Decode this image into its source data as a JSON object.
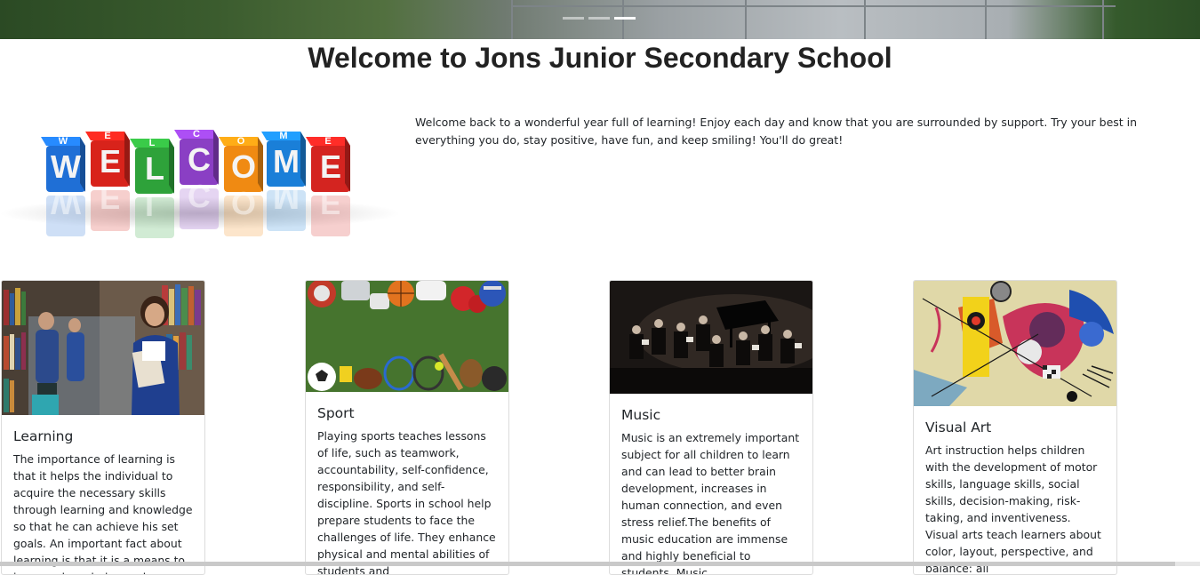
{
  "carousel": {
    "slides": 3,
    "active_index": 2
  },
  "page": {
    "title": "Welcome to Jons Junior Secondary School",
    "intro": "Welcome back to a wonderful year full of learning! Enjoy each day and know that you are surrounded by support. Try your best in everything you do, stay positive, have fun, and keep smiling! You'll do great!"
  },
  "welcome_graphic": {
    "letters": [
      "W",
      "E",
      "L",
      "C",
      "O",
      "M",
      "E"
    ],
    "colors": [
      "#1f6fd6",
      "#d8231b",
      "#2ea23a",
      "#8a3fc4",
      "#f08a12",
      "#1a7fd8",
      "#d42420"
    ]
  },
  "cards": [
    {
      "title": "Learning",
      "text": "The importance of learning is that it helps the individual to acquire the necessary skills through learning and knowledge so that he can achieve his set goals. An important fact about learning is that it is a means to improve knowledge and"
    },
    {
      "title": "Sport",
      "text": "Playing sports teaches lessons of life, such as teamwork, accountability, self-confidence, responsibility, and self-discipline. Sports in school help prepare students to face the challenges of life. They enhance physical and mental abilities of students and"
    },
    {
      "title": "Music",
      "text": "Music is an extremely important subject for all children to learn and can lead to better brain development, increases in human connection, and even stress relief.The benefits of music education are immense and highly beneficial to students. Music"
    },
    {
      "title": "Visual Art",
      "text": "Art instruction helps children with the development of motor skills, language skills, social skills, decision-making, risk-taking, and inventiveness. Visual arts teach learners about color, layout, perspective, and balance: all"
    }
  ]
}
